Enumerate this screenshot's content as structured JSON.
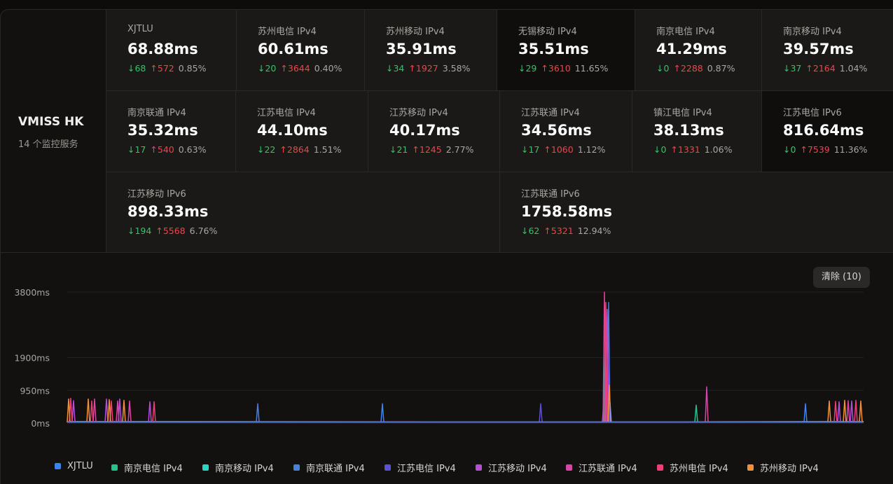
{
  "server": {
    "name": "VMISS HK",
    "subtitle": "14 个监控服务"
  },
  "monitors": [
    {
      "name": "XJTLU",
      "avg": "68.88ms",
      "down": "↓68",
      "up": "↑572",
      "loss": "0.85%"
    },
    {
      "name": "苏州电信 IPv4",
      "avg": "60.61ms",
      "down": "↓20",
      "up": "↑3644",
      "loss": "0.40%"
    },
    {
      "name": "苏州移动 IPv4",
      "avg": "35.91ms",
      "down": "↓34",
      "up": "↑1927",
      "loss": "3.58%"
    },
    {
      "name": "无锡移动 IPv4",
      "avg": "35.51ms",
      "down": "↓29",
      "up": "↑3610",
      "loss": "11.65%"
    },
    {
      "name": "南京电信 IPv4",
      "avg": "41.29ms",
      "down": "↓0",
      "up": "↑2288",
      "loss": "0.87%"
    },
    {
      "name": "南京移动 IPv4",
      "avg": "39.57ms",
      "down": "↓37",
      "up": "↑2164",
      "loss": "1.04%"
    },
    {
      "name": "南京联通 IPv4",
      "avg": "35.32ms",
      "down": "↓17",
      "up": "↑540",
      "loss": "0.63%"
    },
    {
      "name": "江苏电信 IPv4",
      "avg": "44.10ms",
      "down": "↓22",
      "up": "↑2864",
      "loss": "1.51%"
    },
    {
      "name": "江苏移动 IPv4",
      "avg": "40.17ms",
      "down": "↓21",
      "up": "↑1245",
      "loss": "2.77%"
    },
    {
      "name": "江苏联通 IPv4",
      "avg": "34.56ms",
      "down": "↓17",
      "up": "↑1060",
      "loss": "1.12%"
    },
    {
      "name": "镇江电信 IPv4",
      "avg": "38.13ms",
      "down": "↓0",
      "up": "↑1331",
      "loss": "1.06%"
    },
    {
      "name": "江苏电信 IPv6",
      "avg": "816.64ms",
      "down": "↓0",
      "up": "↑7539",
      "loss": "11.36%"
    },
    {
      "name": "江苏移动 IPv6",
      "avg": "898.33ms",
      "down": "↓194",
      "up": "↑5568",
      "loss": "6.76%"
    },
    {
      "name": "江苏联通 IPv6",
      "avg": "1758.58ms",
      "down": "↓62",
      "up": "↑5321",
      "loss": "12.94%"
    }
  ],
  "clear_button": "清除 (10)",
  "chart_data": {
    "type": "line",
    "yticks": [
      "3800ms",
      "1900ms",
      "950ms",
      "0ms"
    ],
    "ylim": [
      0,
      3800
    ],
    "series": [
      {
        "name": "XJTLU",
        "color": "#3b82f6"
      },
      {
        "name": "南京电信 IPv4",
        "color": "#22c38e"
      },
      {
        "name": "南京移动 IPv4",
        "color": "#2dd4bf"
      },
      {
        "name": "南京联通 IPv4",
        "color": "#4c7dd9"
      },
      {
        "name": "江苏电信 IPv4",
        "color": "#5b4fdb"
      },
      {
        "name": "江苏移动 IPv4",
        "color": "#b44fd6"
      },
      {
        "name": "江苏联通 IPv4",
        "color": "#d946a8"
      },
      {
        "name": "苏州电信 IPv4",
        "color": "#ec3f73"
      },
      {
        "name": "苏州移动 IPv4",
        "color": "#f0913a"
      }
    ]
  }
}
